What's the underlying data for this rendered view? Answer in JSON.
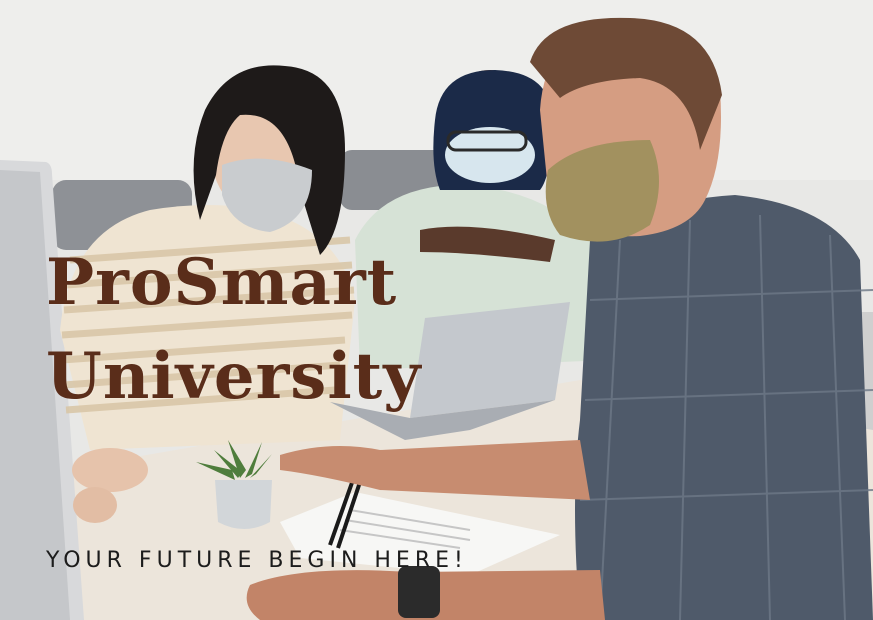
{
  "poster": {
    "title_line1": "ProSmart",
    "title_line2": "University",
    "tagline": "YOUR FUTURE BEGIN HERE!"
  },
  "colors": {
    "title": "#5a2d1a",
    "tagline": "#1c1c1c",
    "background": "#e9e9e7"
  }
}
